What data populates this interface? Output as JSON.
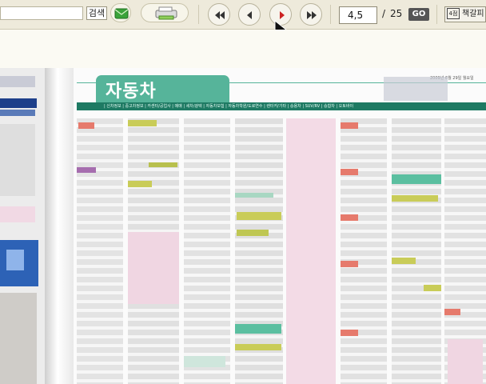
{
  "toolbar": {
    "search_placeholder": "",
    "search_button_label": "검색",
    "mail_icon": "envelope-icon",
    "print_icon": "printer-icon",
    "nav": [
      {
        "name": "first-page-button",
        "icon": "double-left-icon",
        "color": "#333333"
      },
      {
        "name": "prev-page-button",
        "icon": "left-icon",
        "color": "#333333"
      },
      {
        "name": "next-page-button",
        "icon": "right-icon",
        "color": "#cc2222"
      },
      {
        "name": "last-page-button",
        "icon": "double-right-icon",
        "color": "#333333"
      }
    ],
    "page_value": "4,5",
    "page_sep": "/",
    "page_total": "25",
    "go_label": "GO",
    "bookmark_icon_text": "4점",
    "bookmark_label": "책갈피"
  },
  "newspaper": {
    "section_title": "자동차",
    "date": "2009년 6월 29일 월요일",
    "categories": "| 신차정보 | 중고차정보 | 카센타/공업사 | 매매 | 세차/광택 | 자동차보험 | 자동차학원/도로연수 | 렌터카/기타 | 승용차 | SUV/RV | 승합차 | 오토바이"
  },
  "colors": {
    "accent": "#56b49a",
    "category_bar": "#1e7a63",
    "toolbar_bg": "#eeeadb"
  }
}
